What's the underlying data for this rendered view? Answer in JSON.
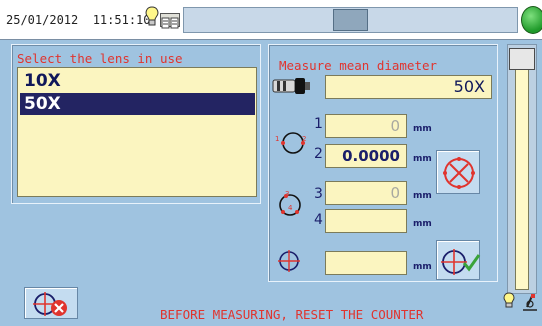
{
  "topbar": {
    "date": "25/01/2012",
    "time": "11:51:10"
  },
  "lens_panel": {
    "title": "Select the lens in use",
    "items": [
      "10X",
      "50X"
    ],
    "selected": "50X"
  },
  "measure_panel": {
    "title": "Measure mean diameter",
    "objective_value": "50X",
    "rows": [
      {
        "index": "1",
        "value": "0",
        "unit": "mm"
      },
      {
        "index": "2",
        "value": "0.0000",
        "unit": "mm"
      },
      {
        "index": "3",
        "value": "0",
        "unit": "mm"
      },
      {
        "index": "4",
        "value": "",
        "unit": "mm"
      }
    ],
    "result": {
      "value": "",
      "unit": "mm"
    }
  },
  "circle_labels": {
    "a1": "1",
    "a2": "2",
    "b3": "3",
    "b4": "4"
  },
  "footer": {
    "message": "BEFORE MEASURING, RESET THE COUNTER"
  },
  "colors": {
    "background": "#9fc3e0",
    "accent_text": "#e0342e",
    "field_fill": "#fbf5c0",
    "selection": "#232462",
    "status_ok": "#1f9a2a"
  },
  "icons": {
    "bulb": "lightbulb-icon",
    "book": "book-icon",
    "objective": "objective-lens-icon",
    "cancel": "cancel-target-icon",
    "confirm": "confirm-target-icon",
    "reset": "reset-target-icon",
    "microscope": "microscope-icon"
  }
}
